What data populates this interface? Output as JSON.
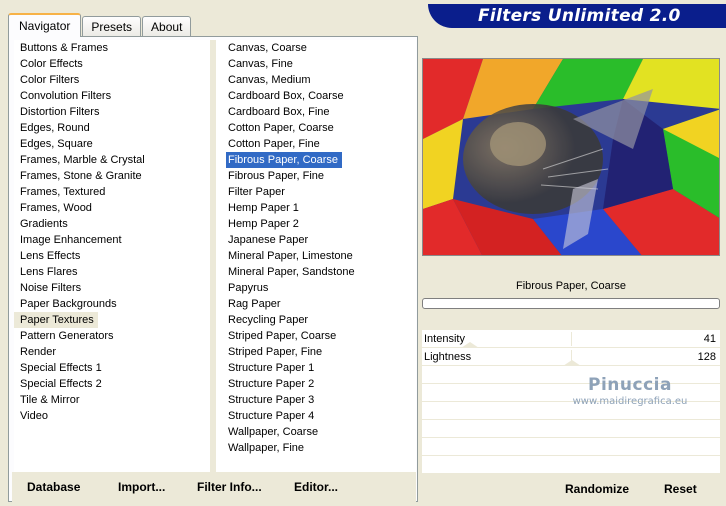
{
  "tabs": [
    {
      "label": "Navigator",
      "active": true
    },
    {
      "label": "Presets",
      "active": false
    },
    {
      "label": "About",
      "active": false
    }
  ],
  "banner": {
    "title": "Filters Unlimited 2.0"
  },
  "categories": [
    "Buttons & Frames",
    "Color Effects",
    "Color Filters",
    "Convolution Filters",
    "Distortion Filters",
    "Edges, Round",
    "Edges, Square",
    "Frames, Marble & Crystal",
    "Frames, Stone & Granite",
    "Frames, Textured",
    "Frames, Wood",
    "Gradients",
    "Image Enhancement",
    "Lens Effects",
    "Lens Flares",
    "Noise Filters",
    "Paper Backgrounds",
    "Paper Textures",
    "Pattern Generators",
    "Render",
    "Special Effects 1",
    "Special Effects 2",
    "Tile & Mirror",
    "Video"
  ],
  "selected_category": "Paper Textures",
  "filters": [
    "Canvas, Coarse",
    "Canvas, Fine",
    "Canvas, Medium",
    "Cardboard Box, Coarse",
    "Cardboard Box, Fine",
    "Cotton Paper, Coarse",
    "Cotton Paper, Fine",
    "Fibrous Paper, Coarse",
    "Fibrous Paper, Fine",
    "Filter Paper",
    "Hemp Paper 1",
    "Hemp Paper 2",
    "Japanese Paper",
    "Mineral Paper, Limestone",
    "Mineral Paper, Sandstone",
    "Papyrus",
    "Rag Paper",
    "Recycling Paper",
    "Striped Paper, Coarse",
    "Striped Paper, Fine",
    "Structure Paper 1",
    "Structure Paper 2",
    "Structure Paper 3",
    "Structure Paper 4",
    "Wallpaper, Coarse",
    "Wallpaper, Fine"
  ],
  "selected_filter": "Fibrous Paper, Coarse",
  "buttons": {
    "database": "Database",
    "import": "Import...",
    "filter_info": "Filter Info...",
    "editor": "Editor...",
    "randomize": "Randomize",
    "reset": "Reset"
  },
  "current_filter_name": "Fibrous Paper, Coarse",
  "params": [
    {
      "label": "Intensity",
      "value": "41",
      "fraction": 0.161
    },
    {
      "label": "Lightness",
      "value": "128",
      "fraction": 0.502
    }
  ],
  "watermark": {
    "name": "Pinuccia",
    "url": "www.maidiregrafica.eu"
  }
}
